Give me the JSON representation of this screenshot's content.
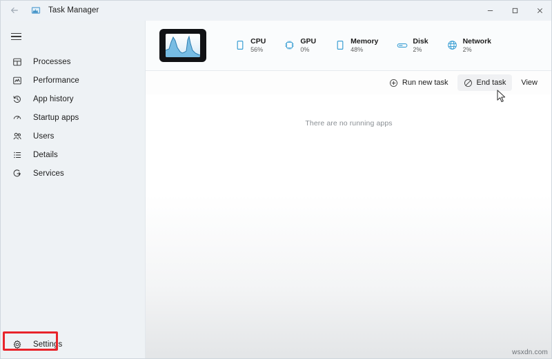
{
  "window": {
    "title": "Task Manager",
    "app_icon": "task-manager-icon",
    "back_icon": "back-arrow-icon",
    "controls": {
      "minimize": "–",
      "maximize": "□",
      "close": "✕"
    }
  },
  "sidebar": {
    "menu_icon": "hamburger-menu-icon",
    "items": [
      {
        "label": "Processes",
        "icon": "processes-icon"
      },
      {
        "label": "Performance",
        "icon": "performance-icon"
      },
      {
        "label": "App history",
        "icon": "app-history-icon"
      },
      {
        "label": "Startup apps",
        "icon": "startup-apps-icon"
      },
      {
        "label": "Users",
        "icon": "users-icon"
      },
      {
        "label": "Details",
        "icon": "details-icon"
      },
      {
        "label": "Services",
        "icon": "services-icon"
      }
    ],
    "settings": {
      "label": "Settings",
      "icon": "gear-icon"
    },
    "highlight_color": "#e8242b"
  },
  "header": {
    "thumbnail_icon": "task-manager-graph-thumbnail",
    "stats": [
      {
        "name": "CPU",
        "value": "56%",
        "icon": "cpu-icon"
      },
      {
        "name": "GPU",
        "value": "0%",
        "icon": "gpu-icon"
      },
      {
        "name": "Memory",
        "value": "48%",
        "icon": "memory-icon"
      },
      {
        "name": "Disk",
        "value": "2%",
        "icon": "disk-icon"
      },
      {
        "name": "Network",
        "value": "2%",
        "icon": "network-icon"
      }
    ],
    "accent_color": "#3b9fd4"
  },
  "toolbar": {
    "run_new_task": {
      "label": "Run new task",
      "icon": "plus-circle-icon"
    },
    "end_task": {
      "label": "End task",
      "icon": "prohibition-icon"
    },
    "view": {
      "label": "View"
    }
  },
  "main": {
    "empty_message": "There are no running apps"
  },
  "watermark": "wsxdn.com"
}
